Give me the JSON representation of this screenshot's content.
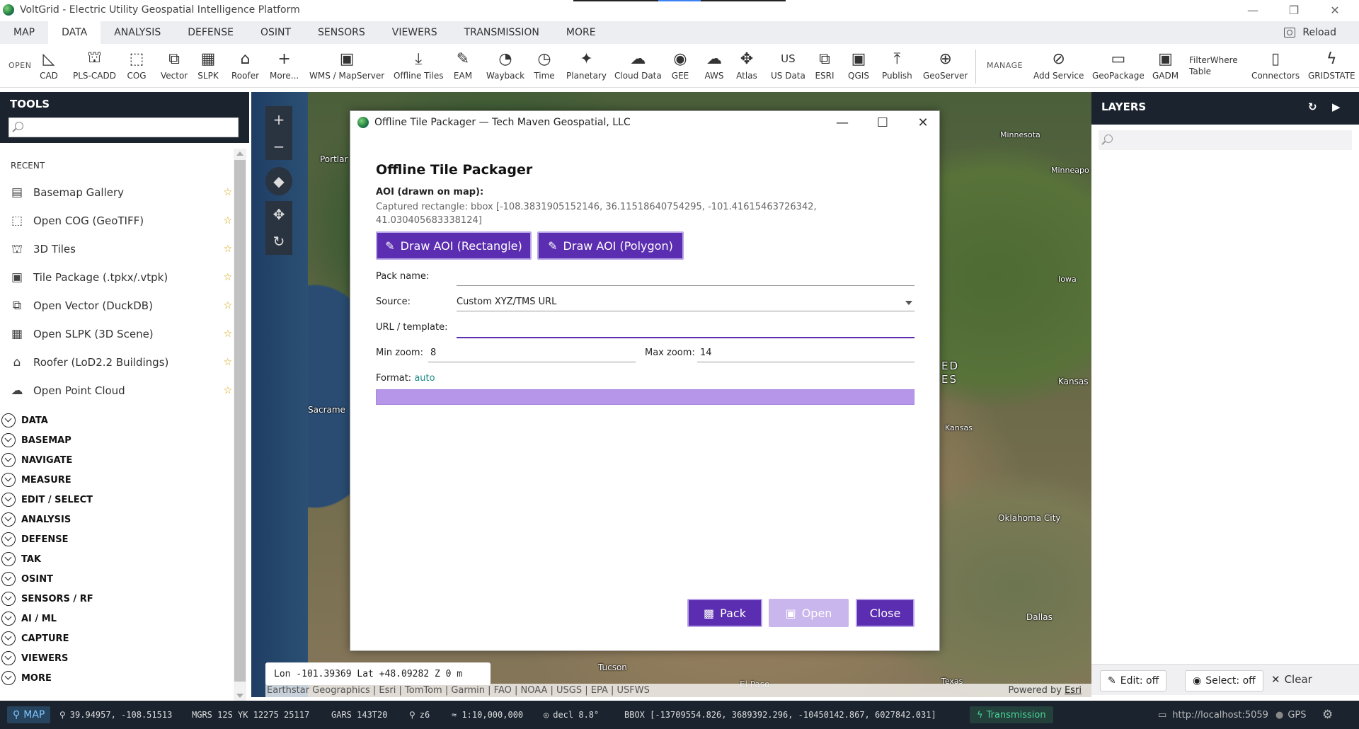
{
  "window": {
    "title": "VoltGrid - Electric Utility Geospatial Intelligence Platform"
  },
  "menu": {
    "tabs": [
      "MAP",
      "DATA",
      "ANALYSIS",
      "DEFENSE",
      "OSINT",
      "SENSORS",
      "VIEWERS",
      "TRANSMISSION",
      "MORE"
    ],
    "active_tab": "DATA",
    "reload_label": "Reload"
  },
  "ribbon": {
    "open_label": "OPEN",
    "manage_label": "MANAGE",
    "open_items": [
      {
        "label": "CAD",
        "icon": "cad-icon"
      },
      {
        "label": "PLS-CADD",
        "icon": "tower-icon"
      },
      {
        "label": "COG",
        "icon": "cube-icon"
      },
      {
        "label": "Vector",
        "icon": "layers-icon"
      },
      {
        "label": "SLPK",
        "icon": "building-icon"
      },
      {
        "label": "Roofer",
        "icon": "house-icon"
      },
      {
        "label": "More...",
        "icon": "plus-icon"
      },
      {
        "label": "WMS / MapServer",
        "icon": "map-book-icon"
      },
      {
        "label": "Offline Tiles",
        "icon": "download-icon"
      },
      {
        "label": "EAM",
        "icon": "pen-icon"
      },
      {
        "label": "Wayback",
        "icon": "wayback-icon"
      },
      {
        "label": "Time",
        "icon": "clock-icon"
      },
      {
        "label": "Planetary",
        "icon": "satellite-icon"
      },
      {
        "label": "Cloud Data",
        "icon": "cloud-icon"
      },
      {
        "label": "GEE",
        "icon": "globe-icon"
      },
      {
        "label": "AWS",
        "icon": "cloud-icon"
      },
      {
        "label": "Atlas",
        "icon": "atlas-icon"
      },
      {
        "label": "US Data",
        "icon": "us-icon"
      },
      {
        "label": "ESRI",
        "icon": "esri-icon"
      },
      {
        "label": "QGIS",
        "icon": "map-book-icon"
      },
      {
        "label": "Publish",
        "icon": "upload-icon"
      },
      {
        "label": "GeoServer",
        "icon": "globe-grid-icon"
      }
    ],
    "us_glyph": "US",
    "manage_items": [
      {
        "label": "Add Service",
        "icon": "link-icon"
      },
      {
        "label": "GeoPackage",
        "icon": "package-icon"
      },
      {
        "label": "GADM",
        "icon": "map-book-icon"
      },
      {
        "label": "FilterWhere",
        "label2": "Table",
        "icon": "none"
      },
      {
        "label": "Connectors",
        "icon": "phone-icon"
      },
      {
        "label": "GRIDSTATE",
        "icon": "bolt-icon"
      }
    ]
  },
  "tools": {
    "title": "TOOLS",
    "search_placeholder": "",
    "recent_label": "RECENT",
    "recent_items": [
      {
        "label": "Basemap Gallery",
        "icon": "gallery-icon"
      },
      {
        "label": "Open COG (GeoTIFF)",
        "icon": "cube-icon"
      },
      {
        "label": "3D Tiles",
        "icon": "tower-icon"
      },
      {
        "label": "Tile Package (.tpkx/.vtpk)",
        "icon": "map-book-icon"
      },
      {
        "label": "Open Vector (DuckDB)",
        "icon": "layers-icon"
      },
      {
        "label": "Open SLPK (3D Scene)",
        "icon": "building-icon"
      },
      {
        "label": "Roofer (LoD2.2 Buildings)",
        "icon": "house-icon"
      },
      {
        "label": "Open Point Cloud",
        "icon": "cloud-icon"
      }
    ],
    "sections": [
      "DATA",
      "BASEMAP",
      "NAVIGATE",
      "MEASURE",
      "EDIT / SELECT",
      "ANALYSIS",
      "DEFENSE",
      "TAK",
      "OSINT",
      "SENSORS / RF",
      "AI / ML",
      "CAPTURE",
      "VIEWERS",
      "MORE"
    ]
  },
  "map": {
    "labels": [
      {
        "text": "Portlar"
      },
      {
        "text": "Sacrame"
      },
      {
        "text": "Minnesota"
      },
      {
        "text": "Minneapo"
      },
      {
        "text": "Iowa"
      },
      {
        "text": "ED"
      },
      {
        "text": "ES"
      },
      {
        "text": "Kansas"
      },
      {
        "text": "Kansas"
      },
      {
        "text": "Oklahoma City"
      },
      {
        "text": "Dallas"
      },
      {
        "text": "Tucson"
      },
      {
        "text": "El Paso"
      },
      {
        "text": "Texas"
      }
    ],
    "coord_readout": "Lon -101.39369  Lat +48.09282  Z 0 m",
    "attribution": "Earthstar Geographics | Esri | TomTom | Garmin | FAO | NOAA | USGS | EPA | USFWS",
    "powered_prefix": "Powered by",
    "powered_brand": "Esri"
  },
  "dialog": {
    "window_title": "Offline Tile Packager — Tech Maven Geospatial, LLC",
    "heading": "Offline Tile Packager",
    "aoi_label": "AOI (drawn on map):",
    "aoi_value": "Captured rectangle: bbox [-108.3831905152146, 36.11518640754295, -101.41615463726342, 41.030405683338124]",
    "draw_rect_label": "Draw AOI (Rectangle)",
    "draw_poly_label": "Draw AOI (Polygon)",
    "pack_name_label": "Pack name:",
    "pack_name_value": "",
    "source_label": "Source:",
    "source_value": "Custom XYZ/TMS URL",
    "url_label": "URL / template:",
    "url_value": "",
    "min_zoom_label": "Min zoom:",
    "min_zoom_value": "8",
    "max_zoom_label": "Max zoom:",
    "max_zoom_value": "14",
    "format_label": "Format:",
    "format_value": "auto",
    "pack_label": "Pack",
    "open_label": "Open",
    "close_label": "Close"
  },
  "layers": {
    "title": "LAYERS",
    "search_placeholder": "",
    "edit_label": "Edit: off",
    "select_label": "Select: off",
    "clear_label": "Clear"
  },
  "statusbar": {
    "mode": "MAP",
    "latlon": "39.94957, -108.51513",
    "mgrs": "MGRS 12S YK 12275 25117",
    "gars": "GARS 143T20",
    "zoom": "z6",
    "scale": "≈ 1:10,000,000",
    "decl": "decl 8.8°",
    "bbox": "BBOX [-13709554.826, 3689392.296, -10450142.867, 6027842.031]",
    "transmission": "Transmission",
    "server": "http://localhost:5059",
    "gps": "GPS"
  }
}
